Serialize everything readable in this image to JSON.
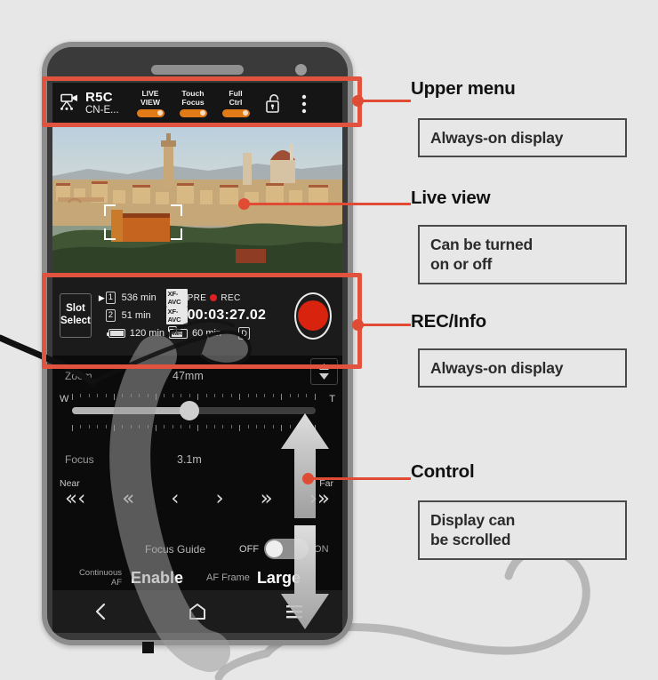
{
  "background_color": "#e7e7e7",
  "accent_color": "#e04b33",
  "highlight_color": "#e2533f",
  "phone": {
    "nav": {
      "back_icon": "chevron-left-icon",
      "home_icon": "home-icon",
      "menu_icon": "hamburger-menu-icon"
    }
  },
  "upper_menu": {
    "camera_icon": "camcorder-tripod-icon",
    "model": "R5C",
    "lens": "CN-E...",
    "toggles": [
      {
        "line1": "LIVE",
        "line2": "VIEW",
        "state": "on"
      },
      {
        "line1": "Touch",
        "line2": "Focus",
        "state": "on"
      },
      {
        "line1": "Full",
        "line2": "Ctrl",
        "state": "on"
      }
    ],
    "lock_icon": "unlocked-padlock-icon",
    "overflow_icon": "kebab-menu-icon"
  },
  "live_view": {
    "scene": "Florence cityscape with Duomo and Palazzo Vecchio at sunset",
    "af_frame": "af-focus-box"
  },
  "rec_info": {
    "slot_select_line1": "Slot",
    "slot_select_line2": "Select",
    "current_slot_marker": "▶",
    "slots": [
      {
        "number": "1",
        "remaining": "536 min",
        "codec": "XF-AVC"
      },
      {
        "number": "2",
        "remaining": "51 min",
        "codec": "XF-AVC"
      }
    ],
    "battery": {
      "icon": "battery-icon",
      "remaining": "120 min"
    },
    "wifi_battery": {
      "icon": "wifi-battery-icon",
      "label": "WiFi",
      "remaining": "60 min"
    },
    "d_indicator": "D",
    "pre_label": "PRE",
    "rec_label": "REC",
    "rec_dot_color": "#e02020",
    "timecode": "00:03:27.02",
    "record_button": "record-button"
  },
  "control": {
    "zoom_label": "Zoom",
    "zoom_value": "47mm",
    "wide_label": "W",
    "tele_label": "T",
    "stepper_icon": "up-down-stepper-icon",
    "focus_label": "Focus",
    "focus_value": "3.1m",
    "near_label": "Near",
    "far_label": "Far",
    "focus_arrows": [
      "«‹",
      "«",
      "‹",
      "›",
      "»",
      "›»"
    ],
    "focus_guide_label": "Focus Guide",
    "focus_guide_off": "OFF",
    "focus_guide_on": "ON",
    "focus_guide_state": "OFF",
    "continuous_af_label_l1": "Continuous",
    "continuous_af_label_l2": "AF",
    "continuous_af_value": "Enable",
    "af_frame_label": "AF Frame",
    "af_frame_value": "Large",
    "scroll_hint_icon": "up-down-scroll-arrows"
  },
  "annotations": [
    {
      "title": "Upper menu",
      "note": "Always-on display"
    },
    {
      "title": "Live view",
      "note_l1": "Can be turned",
      "note_l2": "on or off"
    },
    {
      "title": "REC/Info",
      "note": "Always-on display"
    },
    {
      "title": "Control",
      "note_l1": "Display can",
      "note_l2": "be scrolled"
    }
  ]
}
